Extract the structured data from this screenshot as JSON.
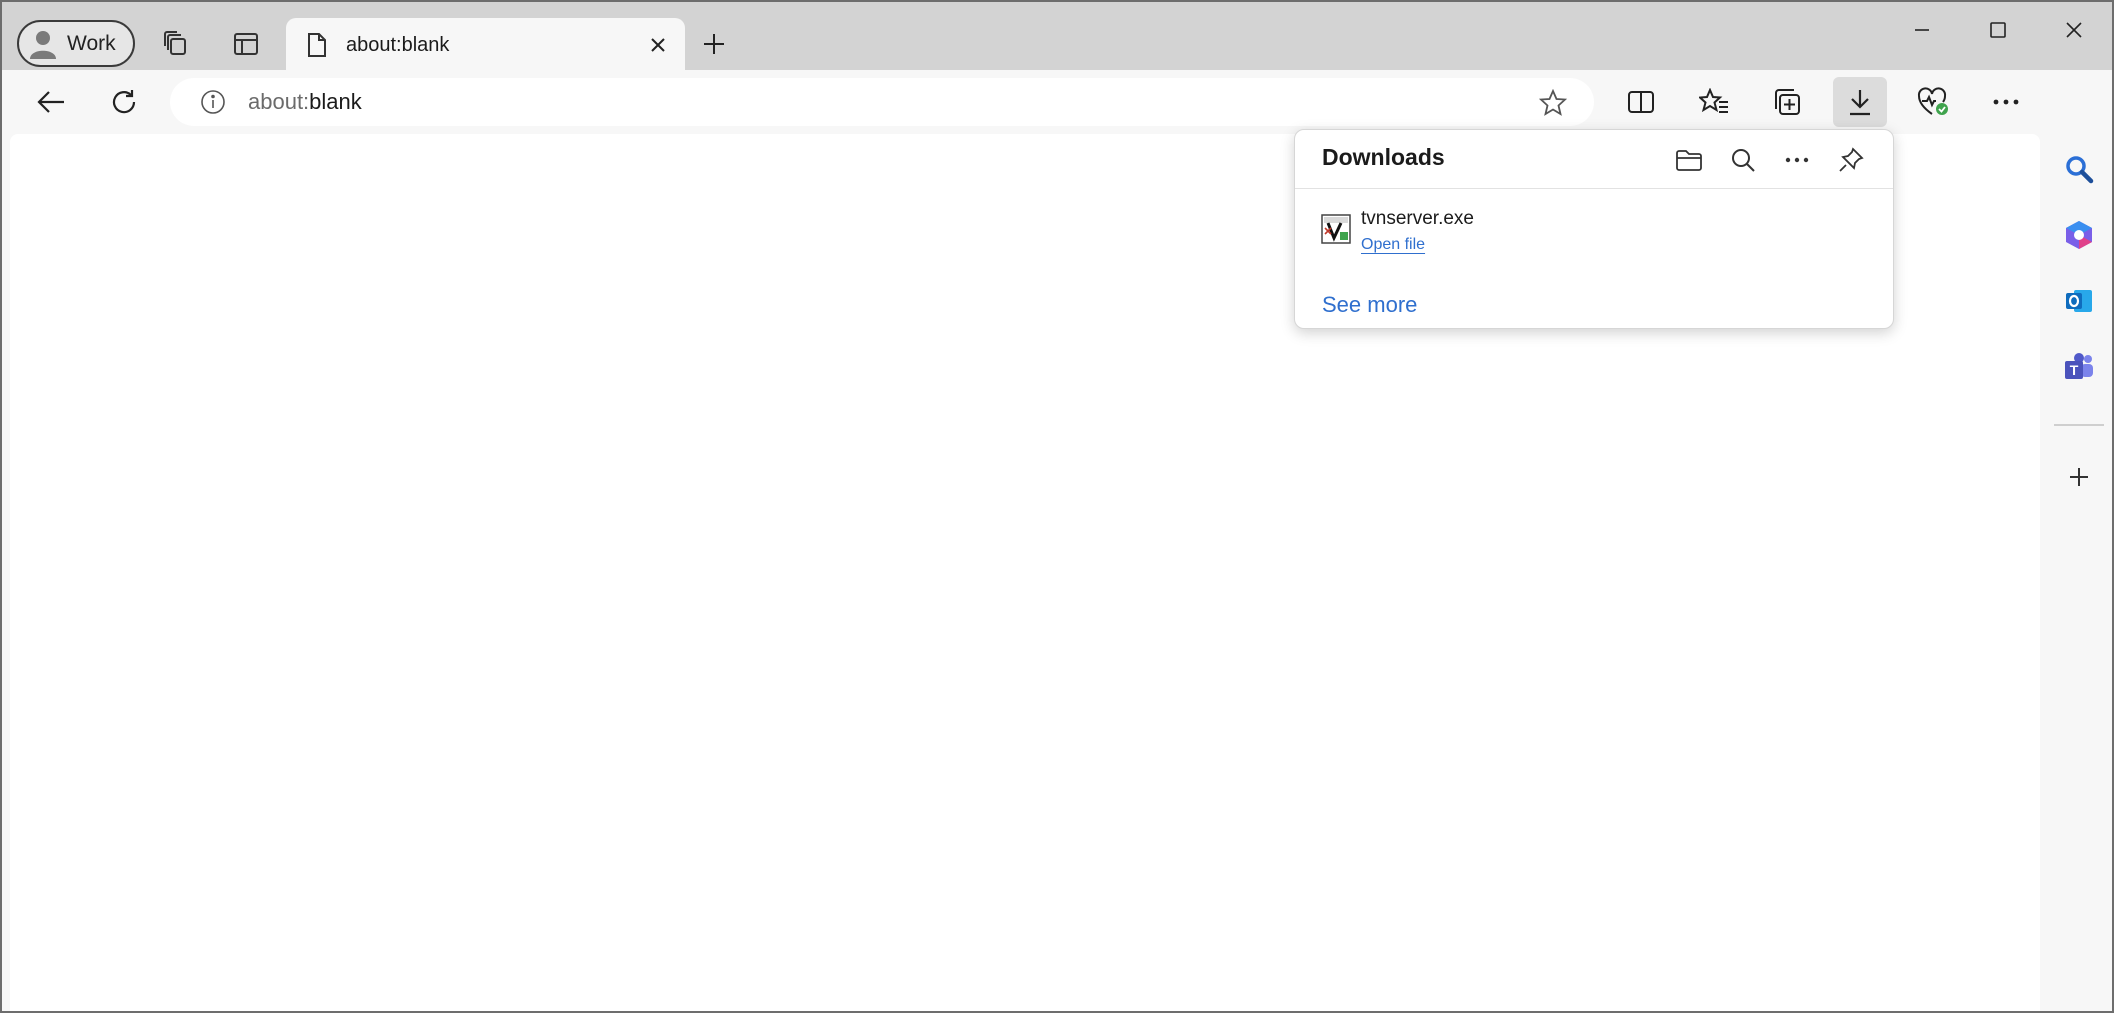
{
  "profile": {
    "label": "Work"
  },
  "tab": {
    "title": "about:blank"
  },
  "address_bar": {
    "scheme": "about:",
    "path": "blank"
  },
  "downloads": {
    "title": "Downloads",
    "items": [
      {
        "file_name": "tvnserver.exe",
        "action": "Open file"
      }
    ],
    "see_more": "See more"
  },
  "colors": {
    "accent_link": "#2f6fce",
    "tabstrip": "#d3d3d3",
    "toolbar": "#f7f7f7"
  },
  "icons": {
    "toolbar": [
      "back-icon",
      "refresh-icon",
      "site-info-icon",
      "favorite-star-icon",
      "split-screen-icon",
      "favorites-icon",
      "collections-icon",
      "downloads-icon",
      "browser-essentials-icon",
      "more-icon",
      "copilot-icon"
    ],
    "sidebar": [
      "search-icon",
      "microsoft-365-icon",
      "outlook-icon",
      "teams-icon",
      "add-icon"
    ]
  }
}
